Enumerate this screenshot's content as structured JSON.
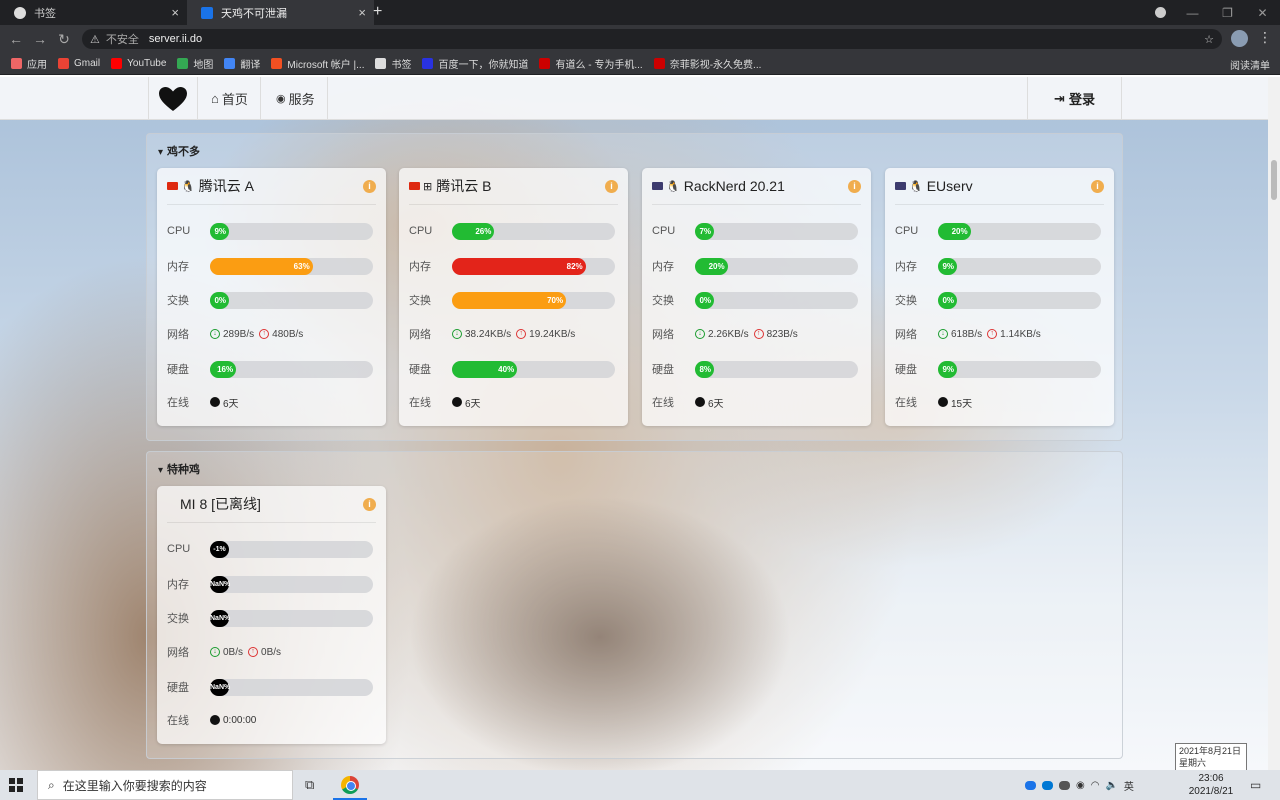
{
  "browser": {
    "tabs": [
      {
        "title": "书签",
        "active": false
      },
      {
        "title": "天鸡不可泄漏",
        "active": true
      }
    ],
    "new_tab": "+",
    "security_label": "不安全",
    "url": "server.ii.do",
    "bookmarks": [
      {
        "label": "应用",
        "color": "#e66"
      },
      {
        "label": "Gmail",
        "color": "#ea4335"
      },
      {
        "label": "YouTube",
        "color": "#f00"
      },
      {
        "label": "地图",
        "color": "#34a853"
      },
      {
        "label": "翻译",
        "color": "#4285f4"
      },
      {
        "label": "Microsoft 帐户 |...",
        "color": "#f25022"
      },
      {
        "label": "书签",
        "color": "#ddd"
      },
      {
        "label": "百度一下，你就知道",
        "color": "#2932e1"
      },
      {
        "label": "有道么 - 专为手机...",
        "color": "#c00"
      },
      {
        "label": "奈菲影视-永久免费...",
        "color": "#c00"
      }
    ],
    "reading_list": "阅读清单"
  },
  "nav": {
    "home_label": "首页",
    "service_label": "服务",
    "login_label": "登录"
  },
  "groups": [
    {
      "title": "鸡不多",
      "cards": [
        {
          "name": "腾讯云 A",
          "flag_color": "#de2910",
          "os": "linux",
          "cpu": 9,
          "cpu_label": "9%",
          "mem": 63,
          "mem_label": "63%",
          "swap": 0,
          "swap_label": "0%",
          "net_in": "289B/s",
          "net_out": "480B/s",
          "disk": 16,
          "disk_label": "16%",
          "uptime": "6天",
          "mem_color": "orange"
        },
        {
          "name": "腾讯云 B",
          "flag_color": "#de2910",
          "os": "windows",
          "cpu": 26,
          "cpu_label": "26%",
          "mem": 82,
          "mem_label": "82%",
          "swap": 70,
          "swap_label": "70%",
          "net_in": "38.24KB/s",
          "net_out": "19.24KB/s",
          "disk": 40,
          "disk_label": "40%",
          "uptime": "6天",
          "mem_color": "red",
          "swap_color": "orange"
        },
        {
          "name": "RackNerd 20.21",
          "flag_color": "#3c3b6e",
          "os": "linux",
          "cpu": 7,
          "cpu_label": "7%",
          "mem": 20,
          "mem_label": "20%",
          "swap": 0,
          "swap_label": "0%",
          "net_in": "2.26KB/s",
          "net_out": "823B/s",
          "disk": 8,
          "disk_label": "8%",
          "uptime": "6天"
        },
        {
          "name": "EUserv",
          "flag_color": "#3c3b6e",
          "os": "linux",
          "cpu": 20,
          "cpu_label": "20%",
          "mem": 9,
          "mem_label": "9%",
          "swap": 0,
          "swap_label": "0%",
          "net_in": "618B/s",
          "net_out": "1.14KB/s",
          "disk": 9,
          "disk_label": "9%",
          "uptime": "15天"
        }
      ]
    },
    {
      "title": "特种鸡",
      "cards": [
        {
          "name": "MI 8 [已离线]",
          "offline": true,
          "cpu_label": "-1%",
          "mem_label": "NaN%",
          "swap_label": "NaN%",
          "net_in": "0B/s",
          "net_out": "0B/s",
          "disk_label": "NaN%",
          "uptime": "0:00:00"
        }
      ]
    }
  ],
  "labels": {
    "cpu": "CPU",
    "mem": "内存",
    "swap": "交换",
    "net": "网络",
    "disk": "硬盘",
    "uptime": "在线"
  },
  "tooltip": {
    "date": "2021年8月21日",
    "weekday": "星期六"
  },
  "taskbar": {
    "search_placeholder": "在这里输入你要搜索的内容",
    "ime": "英",
    "time": "23:06",
    "date": "2021/8/21"
  }
}
